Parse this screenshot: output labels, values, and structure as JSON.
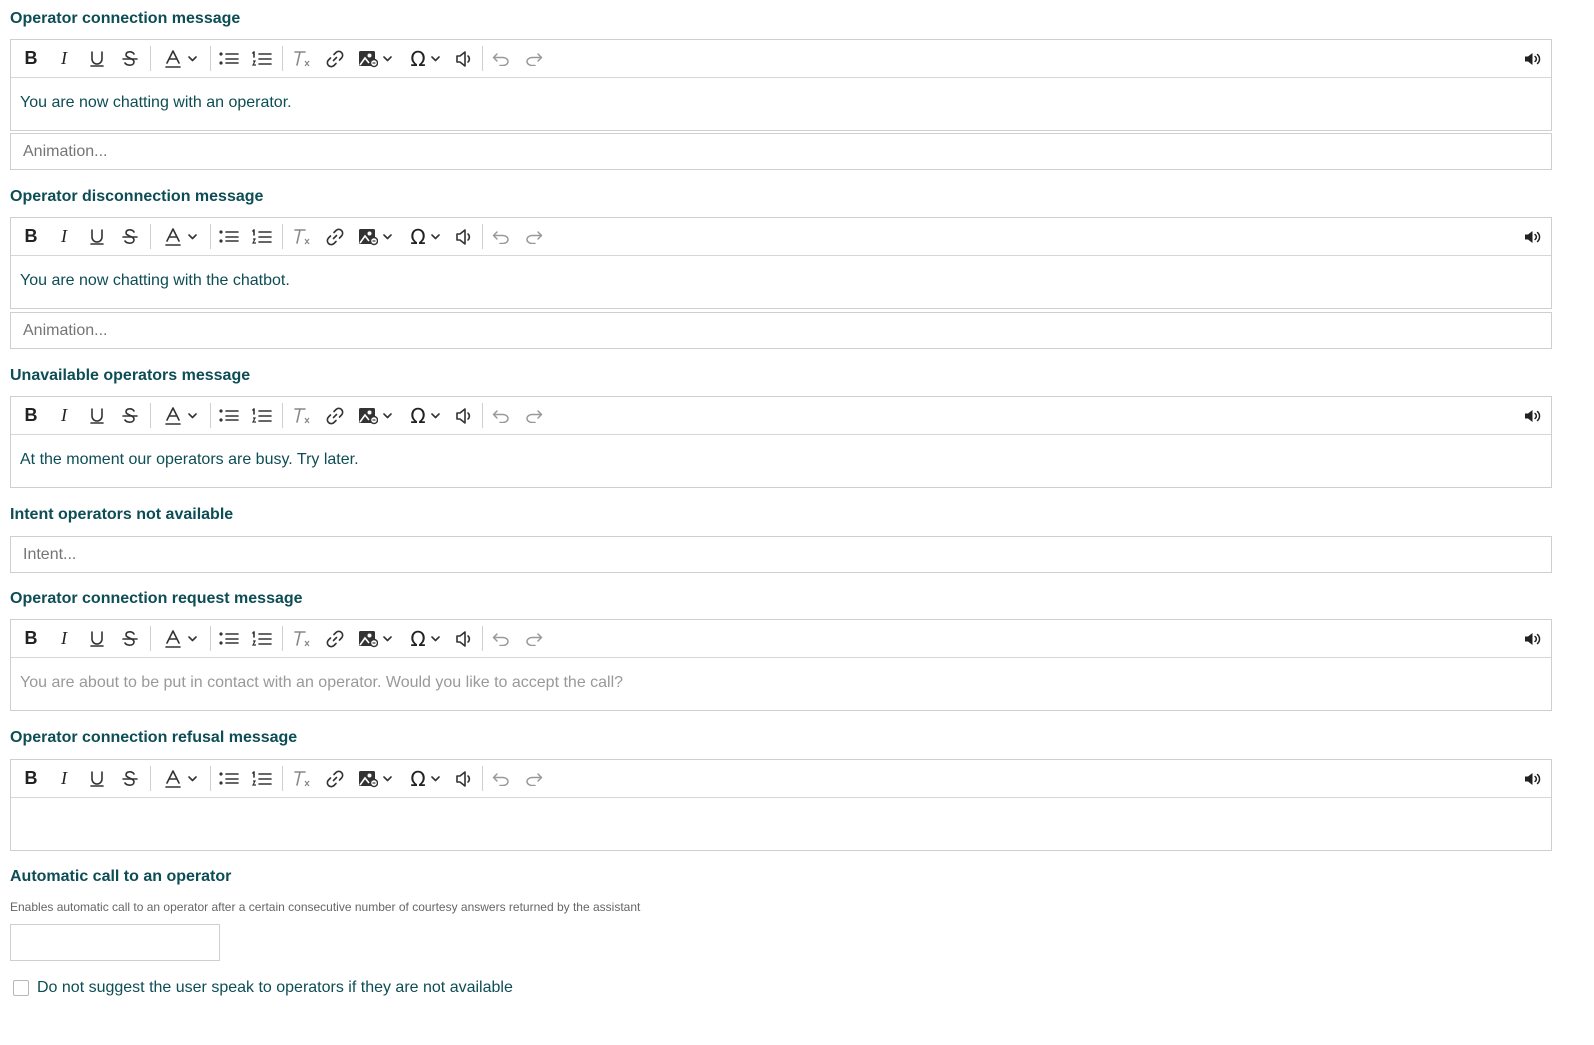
{
  "sections": {
    "operator_connection": {
      "label": "Operator connection message",
      "content": "You are now chatting with an operator.",
      "animation_placeholder": "Animation..."
    },
    "operator_disconnection": {
      "label": "Operator disconnection message",
      "content": "You are now chatting with the chatbot.",
      "animation_placeholder": "Animation..."
    },
    "unavailable_operators": {
      "label": "Unavailable operators message",
      "content": "At the moment our operators are busy. Try later."
    },
    "intent_not_available": {
      "label": "Intent operators not available",
      "placeholder": "Intent..."
    },
    "connection_request": {
      "label": "Operator connection request message",
      "placeholder": "You are about to be put in contact with an operator. Would you like to accept the call?"
    },
    "connection_refusal": {
      "label": "Operator connection refusal message",
      "content": ""
    },
    "automatic_call": {
      "label": "Automatic call to an operator",
      "helper": "Enables automatic call to an operator after a certain consecutive number of courtesy answers returned by the assistant",
      "value": ""
    },
    "no_suggest": {
      "label": "Do not suggest the user speak to operators if they are not available",
      "checked": false
    }
  },
  "toolbar_icons": [
    "bold-icon",
    "italic-icon",
    "underline-icon",
    "strikethrough-icon",
    "font-color-icon",
    "bulleted-list-icon",
    "numbered-list-icon",
    "remove-format-icon",
    "link-icon",
    "image-icon",
    "special-character-icon",
    "text-to-speech-icon",
    "undo-icon",
    "redo-icon",
    "speaker-icon"
  ],
  "colors": {
    "label": "#0d4d55",
    "border": "#cfcfcf",
    "placeholder": "#999999"
  }
}
